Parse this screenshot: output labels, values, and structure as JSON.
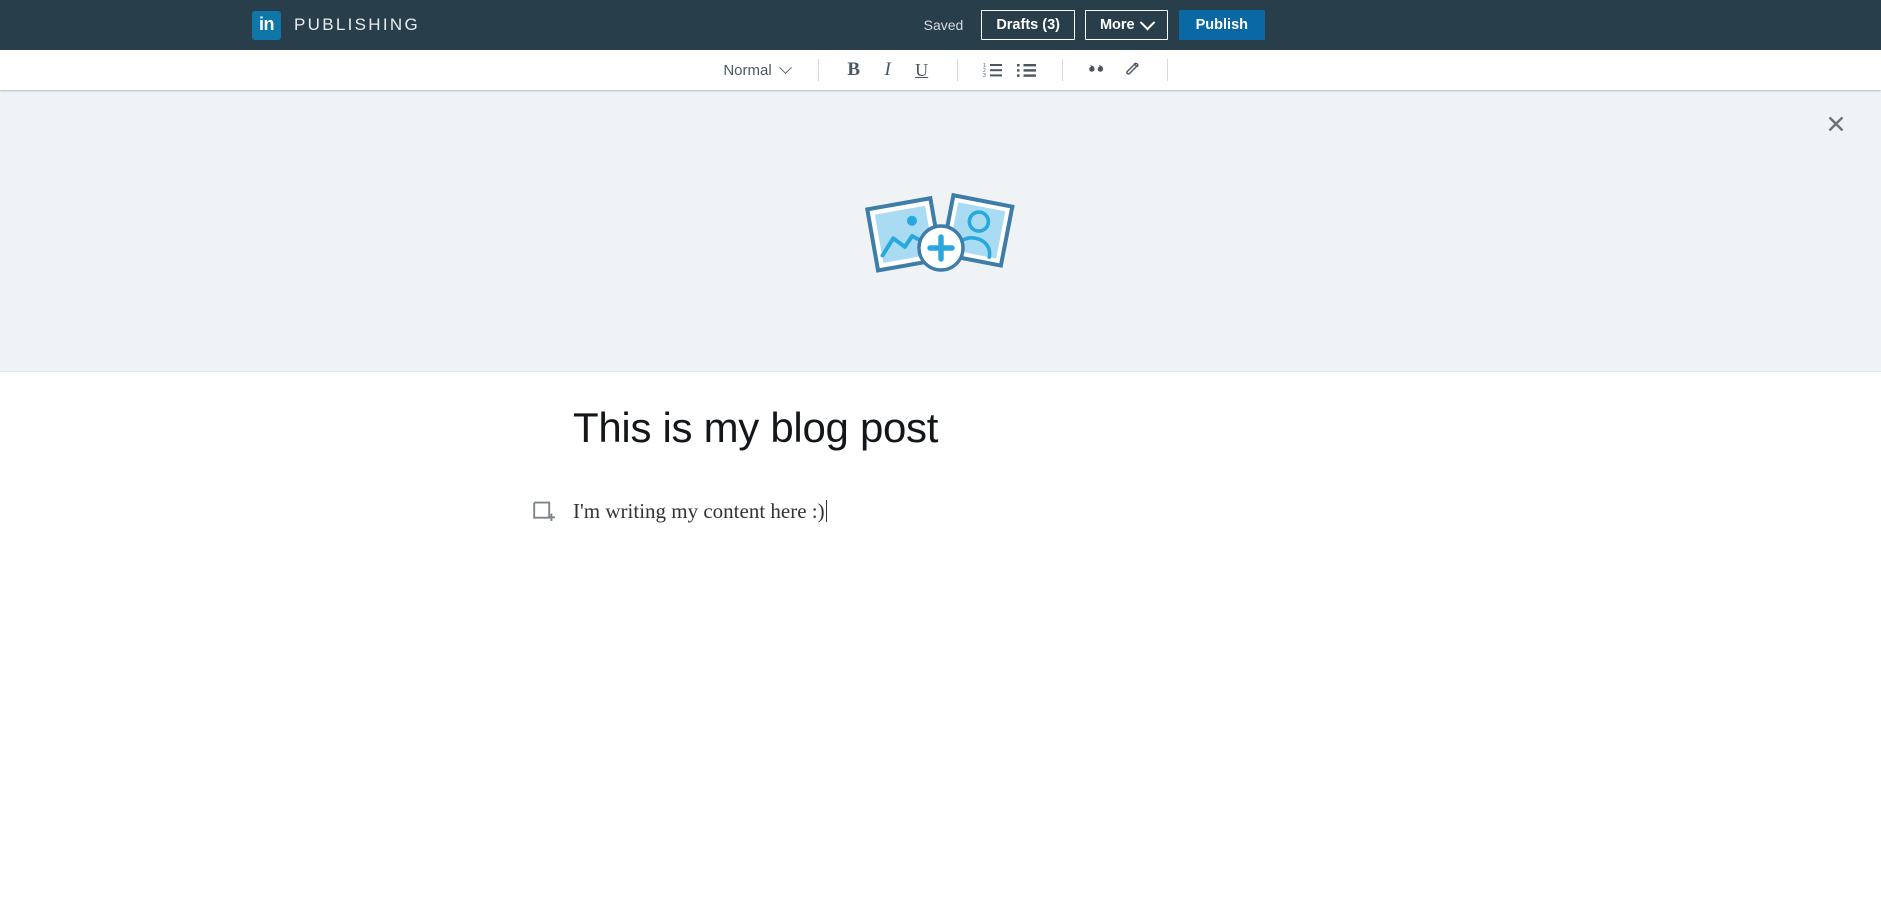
{
  "header": {
    "brand_mark": "in",
    "brand_name": "PUBLISHING",
    "status_label": "Saved",
    "drafts_label": "Drafts (3)",
    "more_label": "More",
    "publish_label": "Publish",
    "accent_color": "#0a69a5",
    "background_color": "#283e4a"
  },
  "toolbar": {
    "style_label": "Normal",
    "bold_label": "B",
    "italic_label": "I",
    "underline_label": "U",
    "quote_label": "””",
    "icons": {
      "style_chevron": "chevron-down-icon",
      "bold": "bold-icon",
      "italic": "italic-icon",
      "underline": "underline-icon",
      "ordered_list": "ordered-list-icon",
      "bullet_list": "bullet-list-icon",
      "quote": "blockquote-icon",
      "link": "link-icon"
    }
  },
  "cover": {
    "icon_name": "add-cover-image-icon",
    "close_icon": "close-icon",
    "close_glyph": "✕",
    "background_color": "#eff3f6",
    "art_border_color": "#3d7da8",
    "art_fill_color": "#a9dcf2",
    "art_detail_color": "#29a8df"
  },
  "editor": {
    "title": "This is my blog post",
    "body_text": "I'm writing my content here :)",
    "add_media_icon": "add-media-icon"
  }
}
